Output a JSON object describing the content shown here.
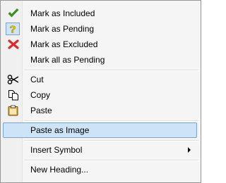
{
  "menu": {
    "items": [
      {
        "label": "Mark as Included",
        "icon": "checkmark-icon"
      },
      {
        "label": "Mark as Pending",
        "icon": "question-mark-icon"
      },
      {
        "label": "Mark as Excluded",
        "icon": "red-x-icon"
      },
      {
        "label": "Mark all as Pending",
        "icon": ""
      },
      {
        "label": "Cut",
        "icon": "scissors-icon"
      },
      {
        "label": "Copy",
        "icon": "copy-icon"
      },
      {
        "label": "Paste",
        "icon": "clipboard-icon"
      },
      {
        "label": "Paste as Image",
        "icon": "",
        "highlighted": true
      },
      {
        "label": "Insert Symbol",
        "icon": "",
        "submenu": true
      },
      {
        "label": "New Heading...",
        "icon": ""
      }
    ]
  },
  "colors": {
    "highlight_bg": "#cde4f7",
    "highlight_border": "#7da2ce",
    "check_green": "#3a9a1f",
    "question_yellow": "#f2d300",
    "x_red": "#e0282b"
  }
}
